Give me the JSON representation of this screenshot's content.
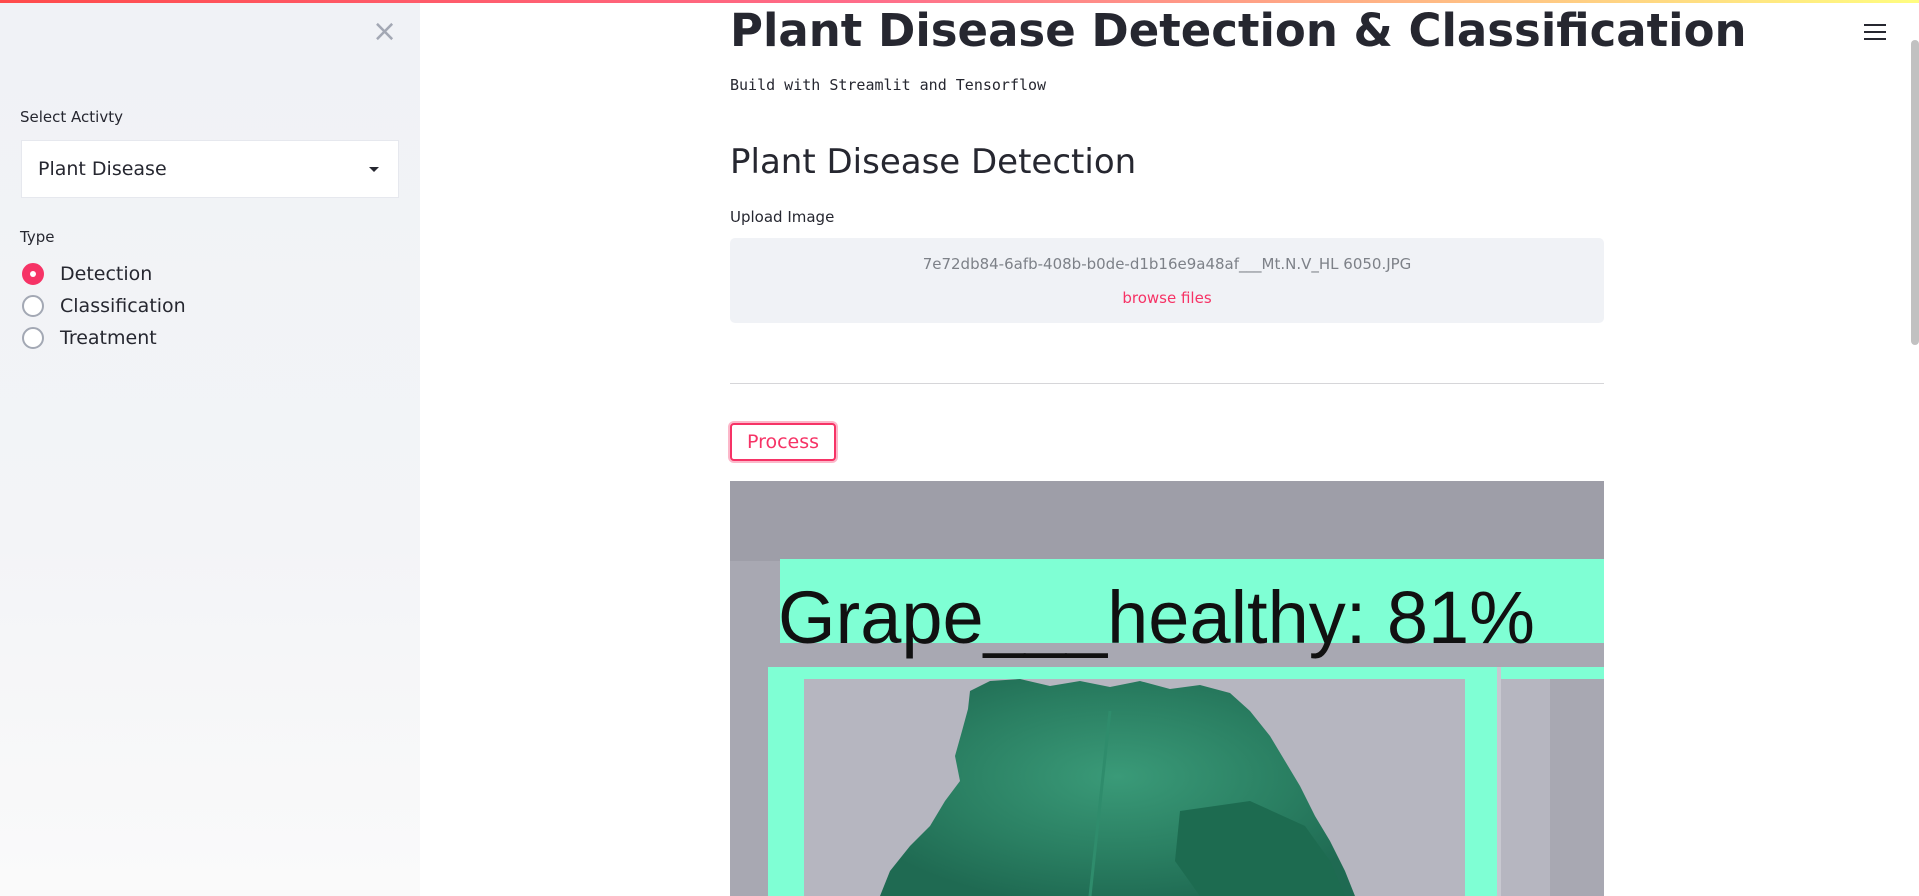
{
  "sidebar": {
    "close_icon": "close-icon",
    "activity_label": "Select Activty",
    "activity_selected": "Plant Disease",
    "type_label": "Type",
    "type_options": [
      "Detection",
      "Classification",
      "Treatment"
    ],
    "type_selected": "Detection"
  },
  "header": {
    "menu_icon": "hamburger-menu-icon"
  },
  "main": {
    "title": "Plant Disease Detection & Classification",
    "subtitle": "Build with Streamlit and Tensorflow",
    "section_title": "Plant Disease Detection",
    "upload": {
      "label": "Upload Image",
      "file_name": "7e72db84-6afb-408b-b0de-d1b16e9a48af___Mt.N.V_HL 6050.JPG",
      "browse_label": "browse files"
    },
    "process_label": "Process",
    "result": {
      "detection_label": "Grape___healthy: 81%"
    }
  },
  "colors": {
    "accent": "#f63366",
    "sidebar_bg": "#f0f2f6",
    "detection_box": "#7fffd4"
  }
}
